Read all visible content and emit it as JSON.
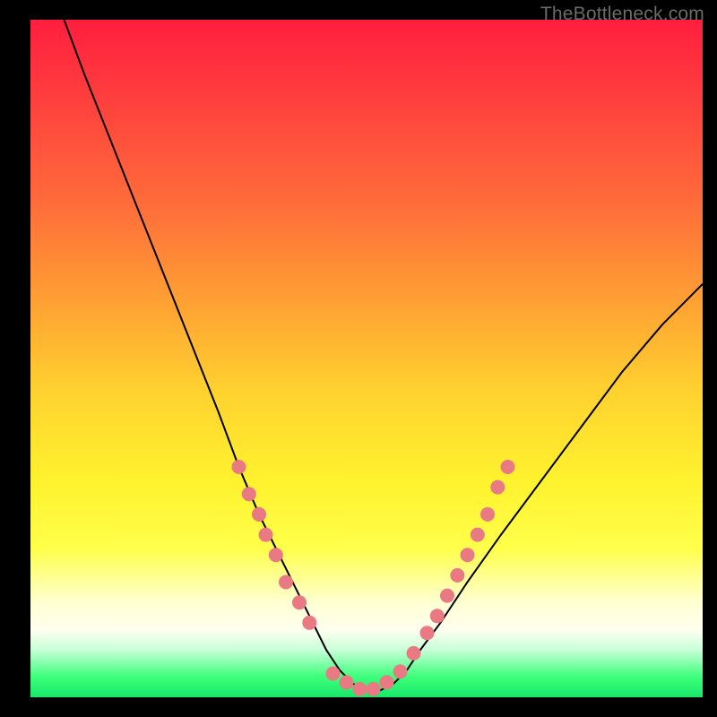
{
  "watermark": "TheBottleneck.com",
  "chart_data": {
    "type": "line",
    "title": "",
    "xlabel": "",
    "ylabel": "",
    "xlim": [
      0,
      100
    ],
    "ylim": [
      0,
      100
    ],
    "series": [
      {
        "name": "bottleneck-curve",
        "x": [
          5,
          8,
          12,
          16,
          20,
          24,
          28,
          31,
          34,
          37,
          40,
          42,
          44,
          46,
          48,
          50,
          52,
          54,
          56,
          58,
          61,
          65,
          70,
          76,
          82,
          88,
          94,
          100
        ],
        "y": [
          100,
          92,
          82,
          72,
          62,
          52,
          42,
          34,
          27,
          21,
          15,
          11,
          7,
          4,
          2,
          1,
          1,
          2,
          4,
          7,
          11,
          17,
          24,
          32,
          40,
          48,
          55,
          61
        ]
      }
    ],
    "markers": {
      "name": "sample-dots",
      "color": "#e97a84",
      "points": [
        {
          "x": 31,
          "y": 34
        },
        {
          "x": 32.5,
          "y": 30
        },
        {
          "x": 34,
          "y": 27
        },
        {
          "x": 35,
          "y": 24
        },
        {
          "x": 36.5,
          "y": 21
        },
        {
          "x": 38,
          "y": 17
        },
        {
          "x": 40,
          "y": 14
        },
        {
          "x": 41.5,
          "y": 11
        },
        {
          "x": 45,
          "y": 3.5
        },
        {
          "x": 47,
          "y": 2.2
        },
        {
          "x": 49,
          "y": 1.2
        },
        {
          "x": 51,
          "y": 1.2
        },
        {
          "x": 53,
          "y": 2.2
        },
        {
          "x": 55,
          "y": 3.8
        },
        {
          "x": 57,
          "y": 6.5
        },
        {
          "x": 59,
          "y": 9.5
        },
        {
          "x": 60.5,
          "y": 12
        },
        {
          "x": 62,
          "y": 15
        },
        {
          "x": 63.5,
          "y": 18
        },
        {
          "x": 65,
          "y": 21
        },
        {
          "x": 66.5,
          "y": 24
        },
        {
          "x": 68,
          "y": 27
        },
        {
          "x": 69.5,
          "y": 31
        },
        {
          "x": 71,
          "y": 34
        }
      ]
    },
    "background_gradient_stops": [
      {
        "pos": 0.0,
        "color": "#ff1f3e"
      },
      {
        "pos": 0.28,
        "color": "#ff6f3a"
      },
      {
        "pos": 0.55,
        "color": "#ffd22f"
      },
      {
        "pos": 0.78,
        "color": "#ffff4a"
      },
      {
        "pos": 0.9,
        "color": "#ffffef"
      },
      {
        "pos": 0.97,
        "color": "#3cff7a"
      },
      {
        "pos": 1.0,
        "color": "#18e86a"
      }
    ]
  }
}
